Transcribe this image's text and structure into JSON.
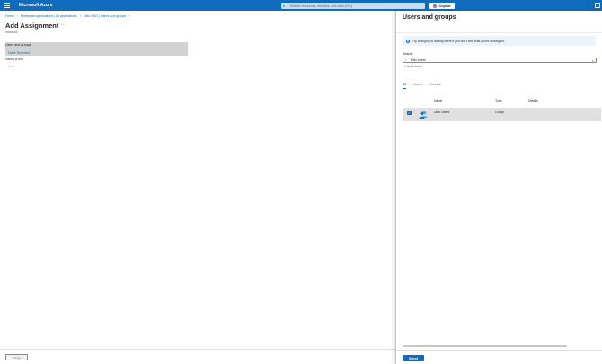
{
  "topbar": {
    "brand": "Microsoft Azure",
    "search_placeholder": "Search resources, services, and docs (G+/)",
    "copilot_label": "Copilot",
    "color": "#0f6cbd"
  },
  "breadcrumb": [
    "Home",
    "Enterprise applications | All applications",
    "Ditto SSO | Users and groups"
  ],
  "main": {
    "title": "Add Assignment",
    "title_more": "···",
    "subtitle": "Windows",
    "users_groups_label": "Users and groups",
    "users_groups_value": "None Selected",
    "role_label": "Select a role",
    "role_value": "User",
    "assign_button": "Assign"
  },
  "panel": {
    "title": "Users and groups",
    "info_text": "Try changing or adding filters if you don't see what you're looking for.",
    "search_label": "Search",
    "search_value": "Ditto Users",
    "result_count": "1 result found",
    "tabs": [
      {
        "label": "All",
        "active": true
      },
      {
        "label": "Users",
        "active": false
      },
      {
        "label": "Groups",
        "active": false
      }
    ],
    "columns": {
      "name": "Name",
      "type": "Type",
      "details": "Details"
    },
    "rows": [
      {
        "name": "Ditto Users",
        "type": "Group",
        "details": "",
        "selected": true
      }
    ],
    "select_button": "Select"
  },
  "icons": {
    "menu": "hamburger-icon",
    "search": "search-icon",
    "copilot": "copilot-icon",
    "info": "info-icon",
    "clear": "clear-icon",
    "group": "group-icon",
    "checkbox": "checkmark-icon"
  }
}
